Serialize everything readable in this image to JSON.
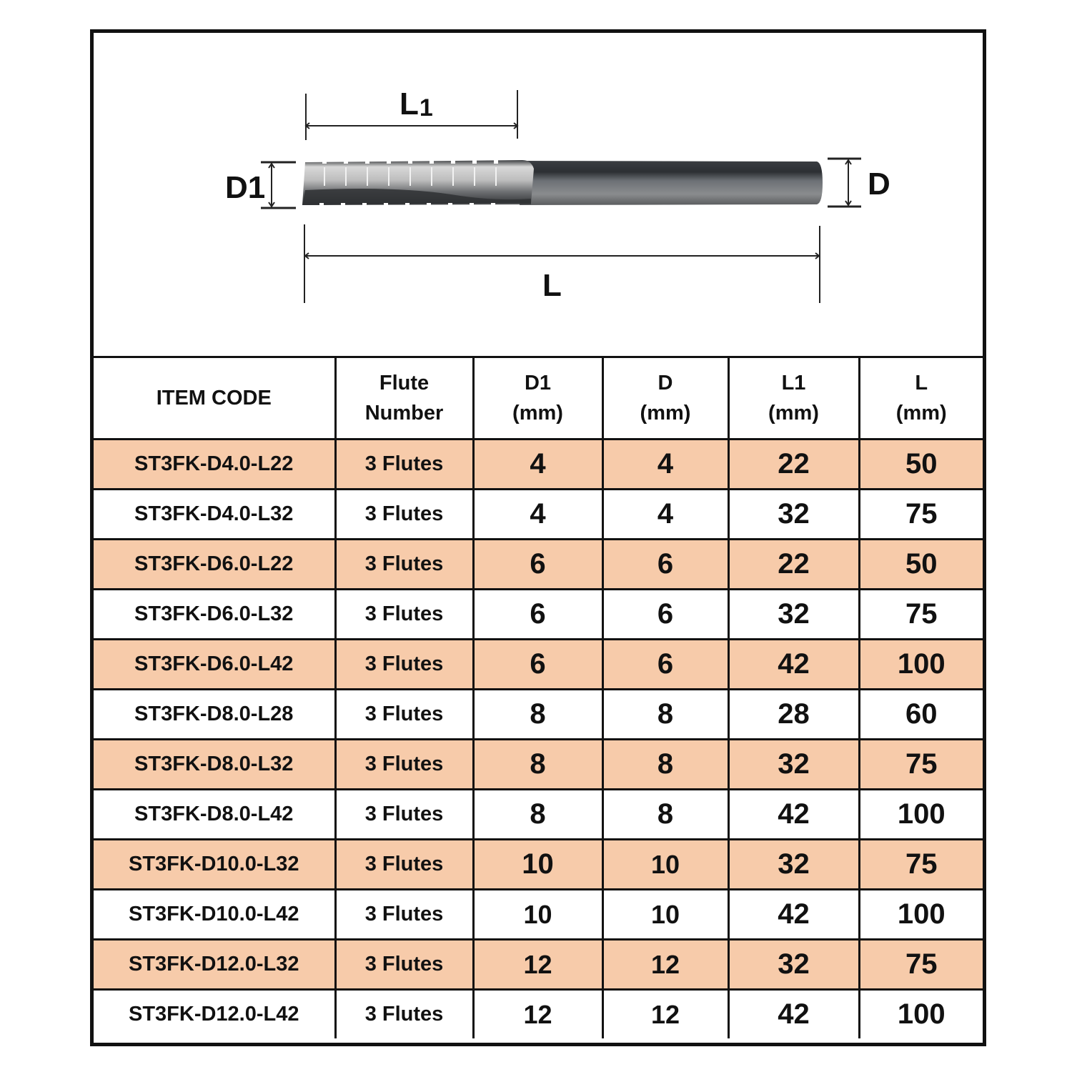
{
  "diagram": {
    "labels": {
      "l1": "L",
      "l1_sub": "1",
      "d1": "D1",
      "d": "D",
      "l": "L"
    },
    "icon": "end-mill-tool-illustration"
  },
  "table": {
    "headers": [
      {
        "line1": "ITEM CODE",
        "line2": ""
      },
      {
        "line1": "Flute",
        "line2": "Number"
      },
      {
        "line1": "D1",
        "line2": "(mm)"
      },
      {
        "line1": "D",
        "line2": "(mm)"
      },
      {
        "line1": "L1",
        "line2": "(mm)"
      },
      {
        "line1": "L",
        "line2": "(mm)"
      }
    ],
    "rows": [
      {
        "code": "ST3FK-D4.0-L22",
        "flutes": "3 Flutes",
        "d1": "4",
        "d": "4",
        "l1": "22",
        "l": "50"
      },
      {
        "code": "ST3FK-D4.0-L32",
        "flutes": "3 Flutes",
        "d1": "4",
        "d": "4",
        "l1": "32",
        "l": "75"
      },
      {
        "code": "ST3FK-D6.0-L22",
        "flutes": "3 Flutes",
        "d1": "6",
        "d": "6",
        "l1": "22",
        "l": "50"
      },
      {
        "code": "ST3FK-D6.0-L32",
        "flutes": "3 Flutes",
        "d1": "6",
        "d": "6",
        "l1": "32",
        "l": "75"
      },
      {
        "code": "ST3FK-D6.0-L42",
        "flutes": "3 Flutes",
        "d1": "6",
        "d": "6",
        "l1": "42",
        "l": "100"
      },
      {
        "code": "ST3FK-D8.0-L28",
        "flutes": "3 Flutes",
        "d1": "8",
        "d": "8",
        "l1": "28",
        "l": "60"
      },
      {
        "code": "ST3FK-D8.0-L32",
        "flutes": "3 Flutes",
        "d1": "8",
        "d": "8",
        "l1": "32",
        "l": "75"
      },
      {
        "code": "ST3FK-D8.0-L42",
        "flutes": "3 Flutes",
        "d1": "8",
        "d": "8",
        "l1": "42",
        "l": "100"
      },
      {
        "code": "ST3FK-D10.0-L32",
        "flutes": "3 Flutes",
        "d1": "10",
        "d": "10",
        "l1": "32",
        "l": "75"
      },
      {
        "code": "ST3FK-D10.0-L42",
        "flutes": "3 Flutes",
        "d1": "10",
        "d": "10",
        "l1": "42",
        "l": "100"
      },
      {
        "code": "ST3FK-D12.0-L32",
        "flutes": "3 Flutes",
        "d1": "12",
        "d": "12",
        "l1": "32",
        "l": "75"
      },
      {
        "code": "ST3FK-D12.0-L42",
        "flutes": "3 Flutes",
        "d1": "12",
        "d": "12",
        "l1": "42",
        "l": "100"
      }
    ]
  },
  "colors": {
    "highlight_row": "#f7cbaa",
    "border": "#111111",
    "background": "#ffffff"
  }
}
